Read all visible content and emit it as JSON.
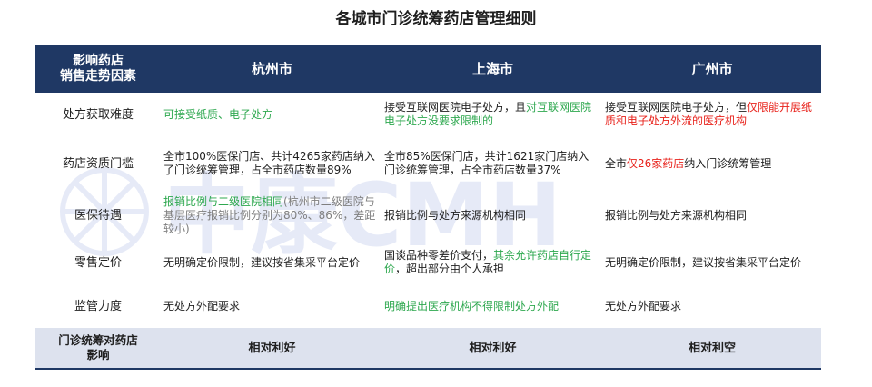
{
  "title": "各城市门诊统筹药店管理细则",
  "watermark": "中康CMH",
  "colors": {
    "header_bg": "#1f3864",
    "footer_bg": "#dde2ee",
    "green": "#2ea84f",
    "red": "#e8221b",
    "gray": "#7f7f7f"
  },
  "header": {
    "factor": [
      "影响药店",
      "销售走势因素"
    ],
    "cities": [
      "杭州市",
      "上海市",
      "广州市"
    ]
  },
  "rows": [
    {
      "factor": "处方获取难度",
      "hangzhou": [
        "可接受纸质、电子处方"
      ],
      "shanghai": [
        "接受互联网医院电子处方，且",
        "对互联网医院电子处方没要求限制的"
      ],
      "guangzhou": [
        "接受互联网医院电子处方，但",
        "仅限能开展纸质和电子处方外流的医疗机构"
      ]
    },
    {
      "factor": "药店资质门槛",
      "hangzhou": [
        "全市100%医保门店、共计4265家药店纳入了门诊统筹管理，占全市药店数量89%"
      ],
      "shanghai": [
        "全市85%医保门店，共计1621家门店纳入门诊统筹管理，占全市药店数量37%"
      ],
      "guangzhou": [
        "全市",
        "仅26家药店",
        "纳入门诊统筹管理"
      ]
    },
    {
      "factor": "医保待遇",
      "hangzhou": [
        "报销比例与二级医院相同",
        "(杭州市二级医院与基层医疗报销比例分别为80%、86%，差距较小)"
      ],
      "shanghai": [
        "报销比例与处方来源机构相同"
      ],
      "guangzhou": [
        "报销比例与处方来源机构相同"
      ]
    },
    {
      "factor": "零售定价",
      "hangzhou": [
        "无明确定价限制，建议按省集采平台定价"
      ],
      "shanghai": [
        "国谈品种零差价支付，",
        "其余允许药店自行定价",
        "，超出部分由个人承担"
      ],
      "guangzhou": [
        "无明确定价限制，建议按省集采平台定价"
      ]
    },
    {
      "factor": "监管力度",
      "hangzhou": [
        "无处方外配要求"
      ],
      "shanghai": [
        "明确提出医疗机构不得限制处方外配"
      ],
      "guangzhou": [
        "无处方外配要求"
      ]
    }
  ],
  "footer": {
    "factor": [
      "门诊统筹对药店",
      "影响"
    ],
    "hangzhou": "相对利好",
    "shanghai": "相对利好",
    "guangzhou": "相对利空"
  }
}
